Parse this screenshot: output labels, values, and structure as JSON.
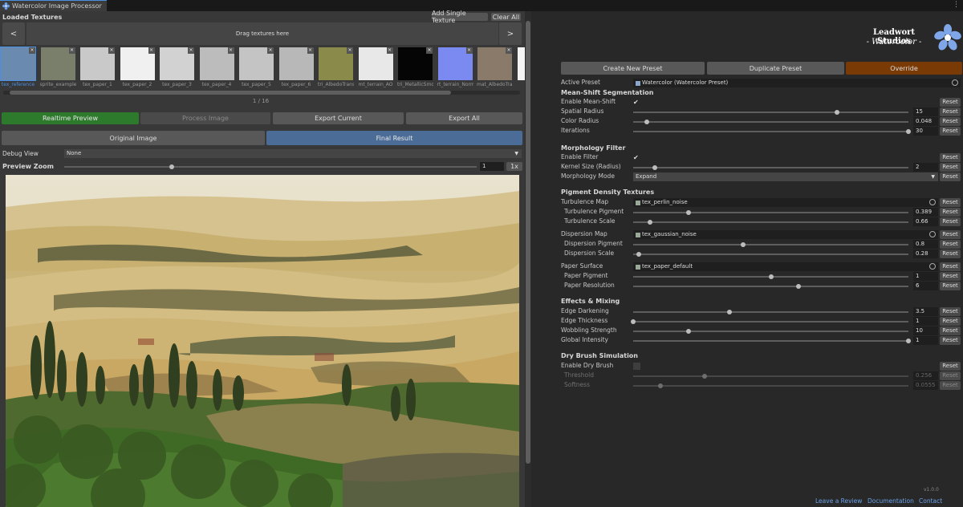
{
  "window": {
    "tab_title": "Watercolor Image Processor",
    "menu_icon": "kebab-menu-icon"
  },
  "left": {
    "section_title": "Loaded Textures",
    "add_single_label": "Add Single Texture",
    "clear_all_label": "Clear All",
    "prev_label": "<",
    "next_label": ">",
    "dropzone_label": "Drag textures here",
    "textures": [
      {
        "label": "tex_reference",
        "selected": true,
        "color": "#6a8ab0"
      },
      {
        "label": "sprite_example",
        "selected": false,
        "color": "#7a7f6c"
      },
      {
        "label": "tex_paper_1",
        "selected": false,
        "color": "#c9c9c9"
      },
      {
        "label": "tex_paper_2",
        "selected": false,
        "color": "#f0f0f0"
      },
      {
        "label": "tex_paper_3",
        "selected": false,
        "color": "#d2d2d2"
      },
      {
        "label": "tex_paper_4",
        "selected": false,
        "color": "#bcbcbc"
      },
      {
        "label": "tex_paper_5",
        "selected": false,
        "color": "#c4c4c4"
      },
      {
        "label": "tex_paper_6",
        "selected": false,
        "color": "#b8b8b8"
      },
      {
        "label": "tri_AlbedoTrans",
        "selected": false,
        "color": "#8a8a4a"
      },
      {
        "label": "mt_terrain_AO",
        "selected": false,
        "color": "#e8e8e8"
      },
      {
        "label": "tri_MetallicSmo",
        "selected": false,
        "color": "#050505"
      },
      {
        "label": "rt_terrain_Norm",
        "selected": false,
        "color": "#7a8af0"
      },
      {
        "label": "mat_AlbedoTrar",
        "selected": false,
        "color": "#8a7a6a"
      },
      {
        "label": "sna",
        "selected": false,
        "color": "#f4f4f4"
      }
    ],
    "pager": "1 / 16",
    "actions": {
      "realtime": "Realtime Preview",
      "process": "Process Image",
      "export_current": "Export Current",
      "export_all": "Export All"
    },
    "view_tabs": {
      "original": "Original Image",
      "final": "Final Result"
    },
    "debug_view": {
      "label": "Debug View",
      "value": "None"
    },
    "preview_zoom": {
      "label": "Preview Zoom",
      "value": "1",
      "zoom_fraction": 0.26,
      "reset_label": "1x"
    }
  },
  "right": {
    "brand": {
      "line1": "Leadwort Studios",
      "line2": "- Watercolor -"
    },
    "preset_buttons": {
      "create": "Create New Preset",
      "duplicate": "Duplicate Preset",
      "override": "Override"
    },
    "active_preset": {
      "label": "Active Preset",
      "value": "Watercolor (Watercolor Preset)"
    },
    "reset_label": "Reset",
    "sections": {
      "mean_shift": "Mean-Shift Segmentation",
      "morphology": "Morphology Filter",
      "pigment": "Pigment Density Textures",
      "effects": "Effects & Mixing",
      "dry_brush": "Dry Brush Simulation"
    },
    "rows": {
      "enable_mean_shift": {
        "label": "Enable Mean-Shift"
      },
      "spatial_radius": {
        "label": "Spatial Radius",
        "value": "15",
        "fraction": 0.74
      },
      "color_radius": {
        "label": "Color Radius",
        "value": "0.048",
        "fraction": 0.05
      },
      "iterations": {
        "label": "Iterations",
        "value": "30",
        "fraction": 1.0
      },
      "enable_filter": {
        "label": "Enable Filter"
      },
      "kernel_size": {
        "label": "Kernel Size (Radius)",
        "value": "2",
        "fraction": 0.08
      },
      "morph_mode": {
        "label": "Morphology Mode",
        "value": "Expand"
      },
      "turbulence_map": {
        "label": "Turbulence Map",
        "value": "tex_perlin_noise"
      },
      "turbulence_pigment": {
        "label": "Turbulence Pigment",
        "value": "0.389",
        "fraction": 0.2
      },
      "turbulence_scale": {
        "label": "Turbulence Scale",
        "value": "0.66",
        "fraction": 0.06
      },
      "dispersion_map": {
        "label": "Dispersion Map",
        "value": "tex_gaussian_noise"
      },
      "dispersion_pigment": {
        "label": "Dispersion Pigment",
        "value": "0.8",
        "fraction": 0.4
      },
      "dispersion_scale": {
        "label": "Dispersion Scale",
        "value": "0.28",
        "fraction": 0.02
      },
      "paper_surface": {
        "label": "Paper Surface",
        "value": "tex_paper_default"
      },
      "paper_pigment": {
        "label": "Paper Pigment",
        "value": "1",
        "fraction": 0.5
      },
      "paper_resolution": {
        "label": "Paper Resolution",
        "value": "6",
        "fraction": 0.6
      },
      "edge_darkening": {
        "label": "Edge Darkening",
        "value": "3.5",
        "fraction": 0.35
      },
      "edge_thickness": {
        "label": "Edge Thickness",
        "value": "1",
        "fraction": 0.0
      },
      "wobbling_strength": {
        "label": "Wobbling Strength",
        "value": "10",
        "fraction": 0.2
      },
      "global_intensity": {
        "label": "Global Intensity",
        "value": "1",
        "fraction": 1.0
      },
      "enable_dry_brush": {
        "label": "Enable Dry Brush"
      },
      "threshold": {
        "label": "Threshold",
        "value": "0.256",
        "fraction": 0.26
      },
      "softness": {
        "label": "Softness",
        "value": "0.0555",
        "fraction": 0.1
      }
    },
    "footer": {
      "review": "Leave a Review",
      "docs": "Documentation",
      "contact": "Contact",
      "version": "v1.0.0"
    }
  }
}
